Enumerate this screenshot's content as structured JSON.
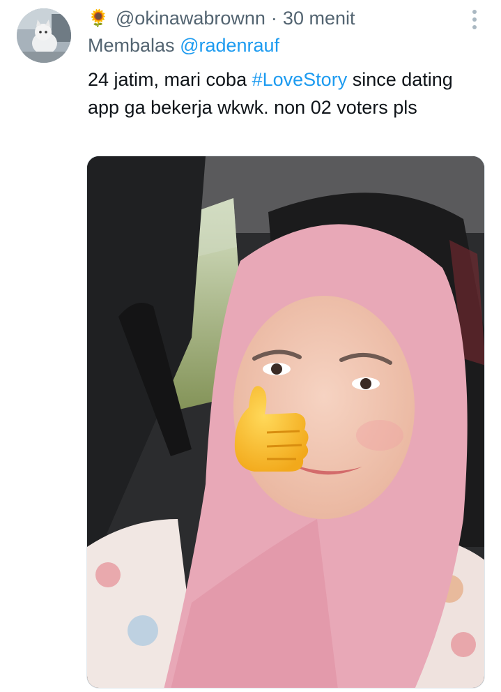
{
  "tweet": {
    "avatar_icon": "cat-avatar",
    "name_emoji": "🌻",
    "handle": "@okinawabrownn",
    "separator": "·",
    "time": "30 menit",
    "more_icon": "more-vertical-icon",
    "reply_prefix": "Membalas",
    "reply_to": "@radenrauf",
    "text_before": "24 jatim, mari coba",
    "hashtag": "#LoveStory",
    "text_after": "since dating app ga bekerja wkwk. non 02 voters pls",
    "media": {
      "type": "photo",
      "thumbs_up_emoji": "👍"
    }
  },
  "colors": {
    "secondary_text": "#536471",
    "link": "#1d9bf0",
    "primary_text": "#0f1419",
    "hijab_pink": "#e8a8b7"
  }
}
